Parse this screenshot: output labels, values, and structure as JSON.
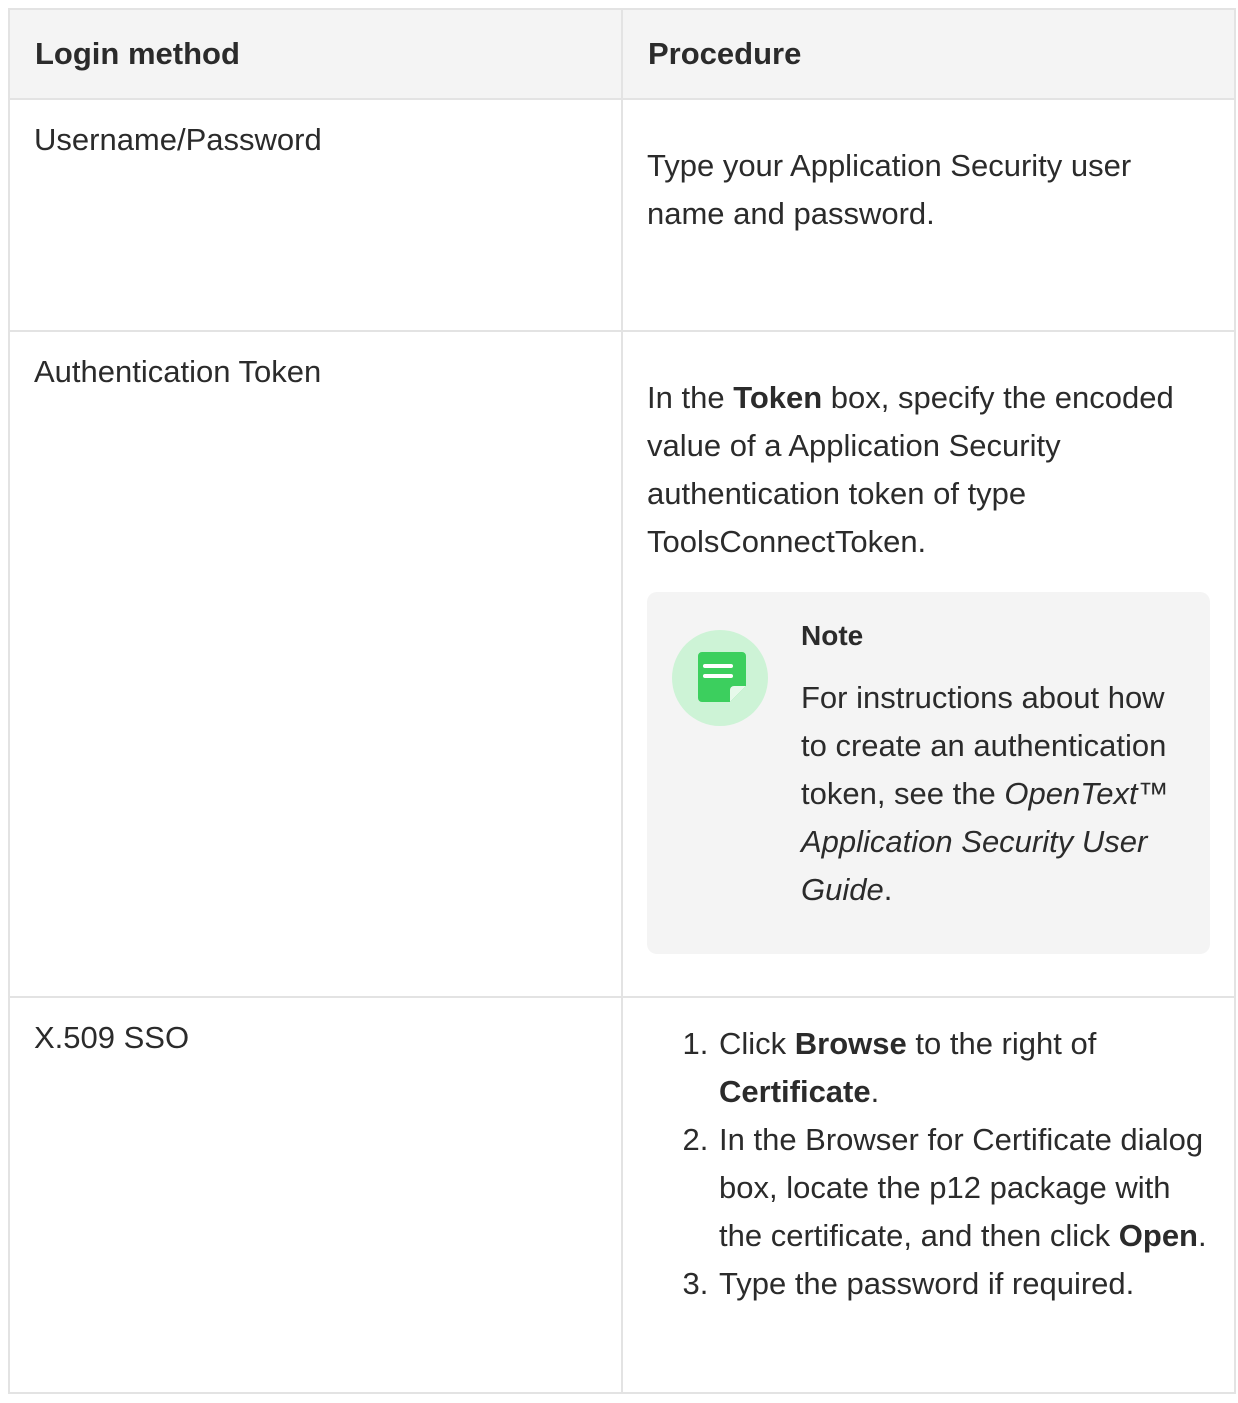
{
  "header": {
    "col1": "Login method",
    "col2": "Procedure"
  },
  "rows": [
    {
      "method": "Username/Password",
      "procedure": "Type your Application Security user name and password."
    },
    {
      "method": "Authentication Token",
      "procedure": {
        "text_before": "In the ",
        "bold": "Token",
        "text_after": " box, specify the encoded value of a Application Security authentication token of type ToolsConnectToken."
      },
      "note": {
        "icon": "note-icon",
        "title": "Note",
        "text_before": "For instructions about how to create an authentication token, see the ",
        "italic": "OpenText™ Application Security User Guide",
        "text_after": "."
      }
    },
    {
      "method": "X.509 SSO",
      "steps": [
        {
          "a": "Click ",
          "b": "Browse",
          "c": " to the right of ",
          "d": "Certificate",
          "e": "."
        },
        {
          "a": "In the Browser for Certificate dialog box, locate the p12 package with the certificate, and then click ",
          "b": "Open",
          "c": "."
        },
        {
          "a": "Type the password if required."
        }
      ]
    }
  ],
  "colors": {
    "header_bg": "#f4f4f4",
    "border": "#e3e3e3",
    "note_bg": "#f4f4f4",
    "icon_circle": "#cdf3d6",
    "icon_fill": "#3ccf5e"
  }
}
